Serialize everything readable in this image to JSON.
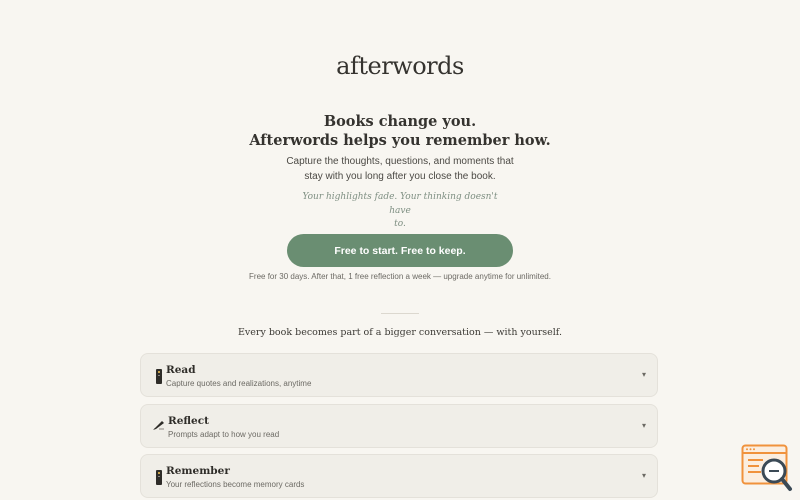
{
  "brand": {
    "name": "afterwords"
  },
  "hero": {
    "headline_line1": "Books change you.",
    "headline_line2": "Afterwords helps you remember how.",
    "subhead_line1": "Capture the thoughts, questions, and moments that",
    "subhead_line2": "stay with you long after you close the book.",
    "tagline_line1": "Your highlights fade. Your thinking doesn't have",
    "tagline_line2": "to.",
    "cta_label": "Free to start. Free to keep.",
    "fineprint": "Free for 30 days. After that, 1 free reflection a week — upgrade anytime for unlimited."
  },
  "features": {
    "intro": "Every book becomes part of a bigger conversation — with yourself.",
    "items": [
      {
        "title": "Read",
        "description": "Capture quotes and realizations, anytime",
        "icon": "book-icon"
      },
      {
        "title": "Reflect",
        "description": "Prompts adapt to how you read",
        "icon": "pen-icon"
      },
      {
        "title": "Remember",
        "description": "Your reflections become memory cards",
        "icon": "book-icon"
      }
    ],
    "chevron_glyph": "▾"
  },
  "colors": {
    "background": "#f8f6f1",
    "accent": "#6a8e72",
    "card": "#f0eee8",
    "badge_orange": "#f0923c"
  }
}
